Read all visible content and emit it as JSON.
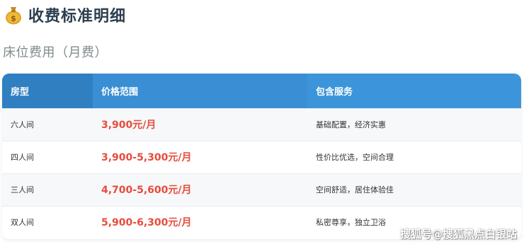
{
  "header": {
    "icon": "money-bag-icon",
    "title": "收费标准明细"
  },
  "section": {
    "subtitle": "床位费用（月费）"
  },
  "table": {
    "columns": [
      "房型",
      "价格范围",
      "包含服务"
    ],
    "rows": [
      {
        "room": "六人间",
        "price": "3,900元/月",
        "service": "基础配置，经济实惠"
      },
      {
        "room": "四人间",
        "price": "3,900-5,300元/月",
        "service": "性价比优选，空间合理"
      },
      {
        "room": "三人间",
        "price": "4,700-5,600元/月",
        "service": "空间舒适，居住体验佳"
      },
      {
        "room": "双人间",
        "price": "5,900-6,300元/月",
        "service": "私密尊享，独立卫浴"
      }
    ]
  },
  "watermark": "搜狐号@搜狐黑点白银站",
  "colors": {
    "header_bg": "#3a8fd4",
    "price": "#e74c3c",
    "title": "#2c3e50"
  }
}
